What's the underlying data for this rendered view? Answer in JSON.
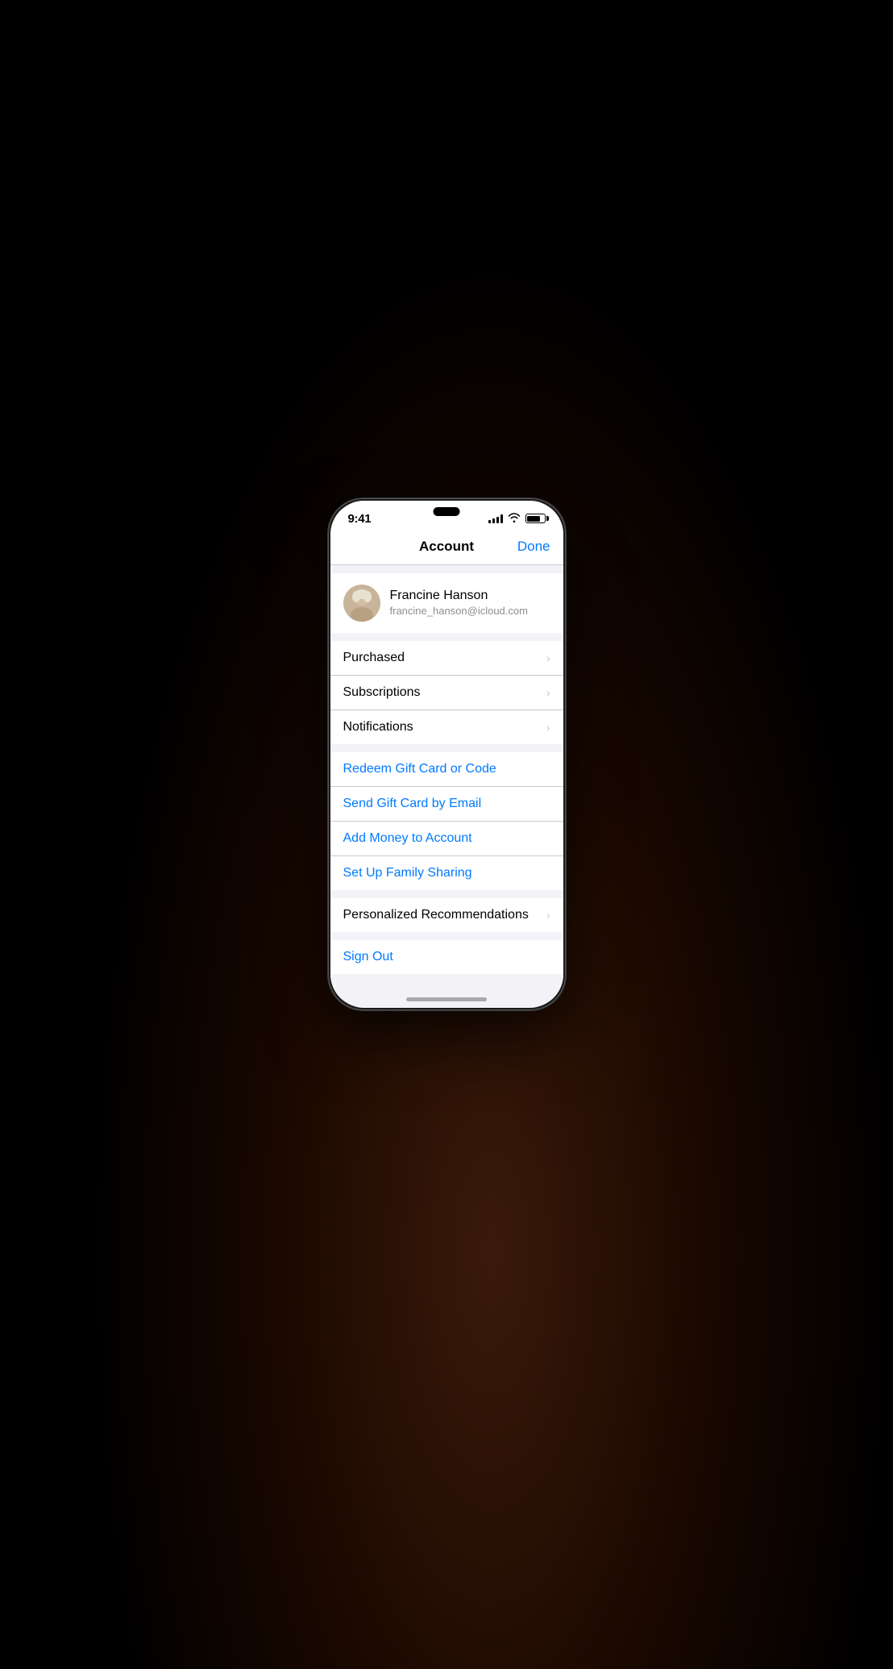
{
  "background": {
    "color": "#000000"
  },
  "phone": {
    "status_bar": {
      "time": "9:41",
      "signal_bars": 4,
      "wifi": true,
      "battery": 80
    },
    "nav": {
      "title": "Account",
      "done_label": "Done"
    },
    "profile": {
      "name": "Francine Hanson",
      "email": "francine_hanson@icloud.com"
    },
    "menu_section_1": {
      "items": [
        {
          "label": "Purchased",
          "has_chevron": true
        },
        {
          "label": "Subscriptions",
          "has_chevron": true
        },
        {
          "label": "Notifications",
          "has_chevron": true
        }
      ]
    },
    "menu_section_2": {
      "items": [
        {
          "label": "Redeem Gift Card or Code",
          "has_chevron": false,
          "blue": true
        },
        {
          "label": "Send Gift Card by Email",
          "has_chevron": false,
          "blue": true
        },
        {
          "label": "Add Money to Account",
          "has_chevron": false,
          "blue": true
        },
        {
          "label": "Set Up Family Sharing",
          "has_chevron": false,
          "blue": true
        }
      ]
    },
    "menu_section_3": {
      "items": [
        {
          "label": "Personalized Recommendations",
          "has_chevron": true
        }
      ]
    },
    "menu_section_4": {
      "items": [
        {
          "label": "Sign Out",
          "has_chevron": false,
          "blue": true
        }
      ]
    }
  }
}
